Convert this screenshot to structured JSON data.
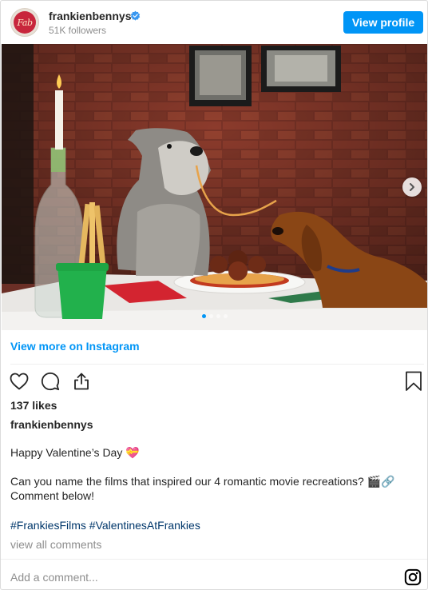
{
  "header": {
    "avatar_text": "Fab",
    "username": "frankienbennys",
    "followers": "51K followers",
    "view_profile_label": "View profile",
    "verified_icon": "verified-badge-icon"
  },
  "photo": {
    "description_icon": "post-photo",
    "carousel": {
      "slides": 4,
      "current": 1
    },
    "next_icon": "chevron-right-icon"
  },
  "view_more_label": "View more on Instagram",
  "actions": {
    "like_icon": "heart-icon",
    "comment_icon": "comment-icon",
    "share_icon": "share-icon",
    "save_icon": "bookmark-icon"
  },
  "likes": "137 likes",
  "caption": {
    "username": "frankienbennys",
    "line1": "Happy Valentine’s Day 💝",
    "line2a": "Can you name the films that inspired our 4 romantic movie recreations? 🎬🔗",
    "line2b": "Comment below!",
    "hashtags": [
      "#FrankiesFilms",
      "#ValentinesAtFrankies"
    ]
  },
  "view_comments_label": "view all comments",
  "comment_placeholder": "Add a comment...",
  "colors": {
    "accent": "#0095f6",
    "hashtag": "#00376b",
    "muted": "#8e8e8e"
  }
}
